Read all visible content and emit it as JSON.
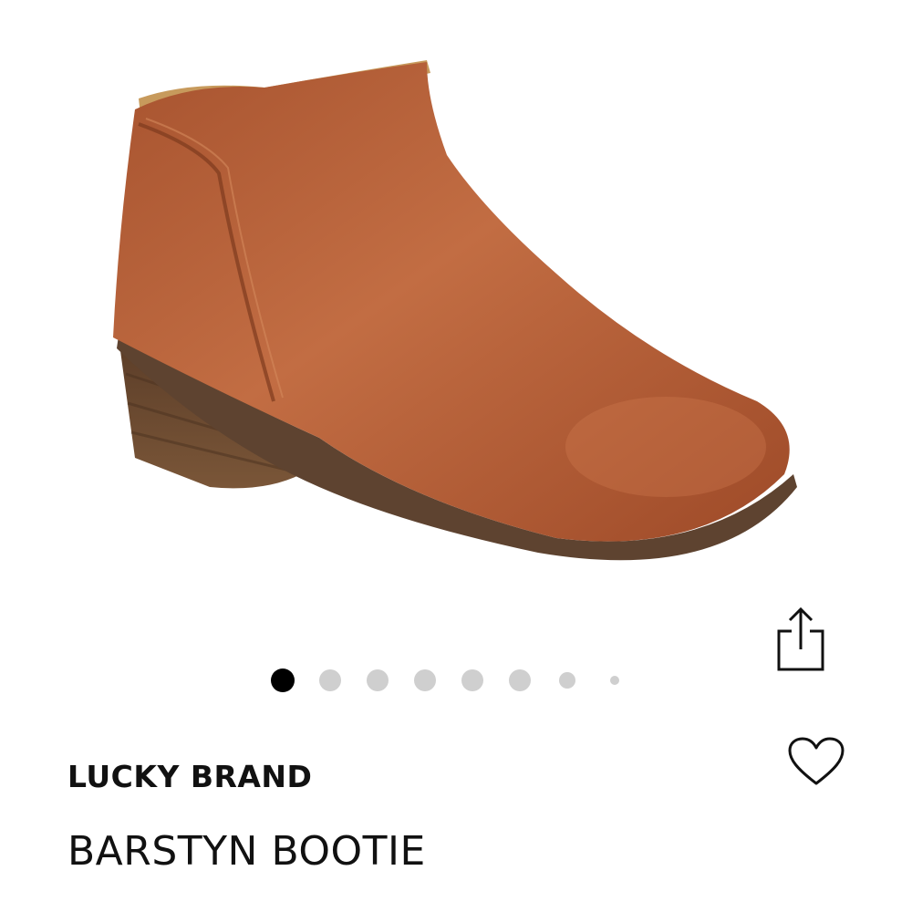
{
  "product": {
    "brand": "LUCKY BRAND",
    "name": "BARSTYN BOOTIE",
    "image_subject": "brown leather ankle bootie"
  },
  "carousel": {
    "total": 8,
    "active_index": 0
  },
  "actions": {
    "share_icon": "share-icon",
    "favorite_icon": "heart-icon"
  },
  "colors": {
    "text": "#111111",
    "dot_active": "#000000",
    "dot_inactive": "#cfcfcf",
    "leather": "#b5623a",
    "heel": "#6b4a32"
  }
}
